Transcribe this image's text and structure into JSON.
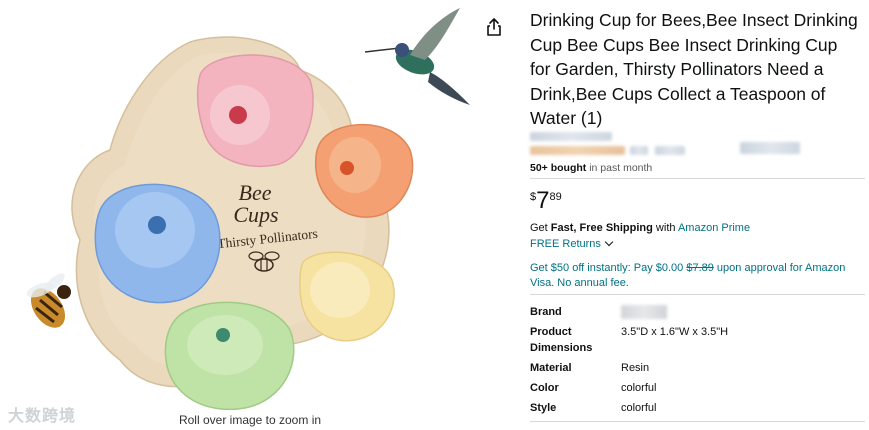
{
  "product": {
    "title": "Drinking Cup for Bees,Bee Insect Drinking Cup Bee Cups Bee Insect Drinking Cup for Garden, Thirsty Pollinators Need a Drink,Bee Cups Collect a Teaspoon of Water (1)",
    "bought_count": "50+ bought",
    "bought_suffix": " in past month",
    "price": {
      "currency": "$",
      "whole": "7",
      "fraction": "89"
    },
    "shipping": {
      "prefix": "Get ",
      "bold": "Fast, Free Shipping",
      "middle": " with ",
      "link": "Amazon Prime"
    },
    "returns_label": "FREE Returns",
    "offer": {
      "part1": "Get $50 off instantly: Pay $0.00 ",
      "strike": "$7.89",
      "part2": " upon approval for Amazon Visa. No annual fee."
    },
    "specs": [
      {
        "key": "Brand",
        "value": ""
      },
      {
        "key": "Product Dimensions",
        "value": "3.5\"D x 1.6\"W x 3.5\"H"
      },
      {
        "key": "Material",
        "value": "Resin"
      },
      {
        "key": "Color",
        "value": "colorful"
      },
      {
        "key": "Style",
        "value": "colorful"
      }
    ]
  },
  "image": {
    "board_text_line1": "Bee",
    "board_text_line2": "Cups",
    "board_text_line3": "Thirsty Pollinators",
    "zoom_hint": "Roll over image to zoom in",
    "watermark": "大数跨境"
  },
  "icons": {
    "share": "share-icon",
    "returns_chevron": "chevron-down-icon"
  },
  "colors": {
    "link": "#007185",
    "cup_pink": "#f3b4c0",
    "cup_orange": "#f4a072",
    "cup_blue": "#8fb7ec",
    "cup_yellow": "#f6e3a2",
    "cup_green": "#bfe3a7",
    "board": "#e8d8bf"
  }
}
